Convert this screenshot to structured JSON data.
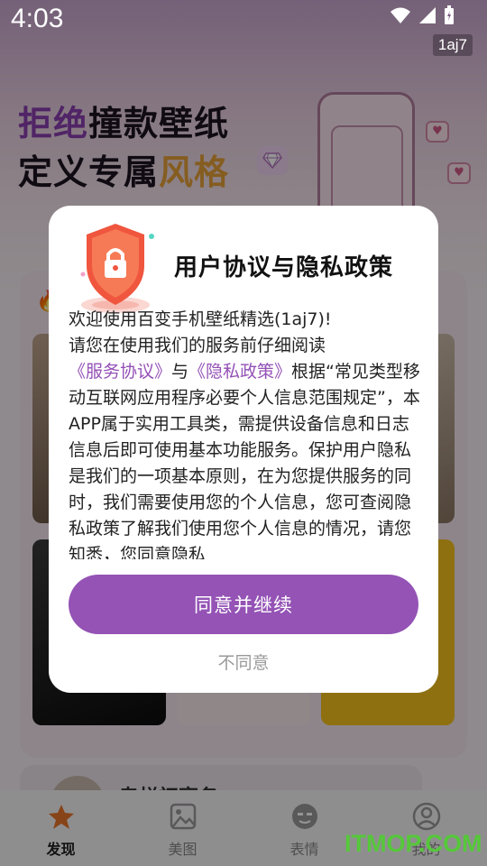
{
  "status_bar": {
    "time": "4:03",
    "version_badge": "1aj7"
  },
  "hero": {
    "line1_highlight": "拒绝",
    "line1_rest": "撞款壁纸",
    "line2_start": "定义专属",
    "line2_highlight": "风格"
  },
  "background_card": {
    "title_partial": "专栏初享务"
  },
  "dialog": {
    "title": "用户协议与隐私政策",
    "body_line1": "欢迎使用百变手机壁纸精选(1aj7)!",
    "body_pre": "请您在使用我们的服务前仔细阅读",
    "link_service": "《服务协议》",
    "body_and": "与",
    "link_privacy": "《隐私政策》",
    "body_post": "根据“常见类型移动互联网应用程序必要个人信息范围规定”，本APP属于实用工具类，需提供设备信息和日志信息后即可使用基本功能服务。保护用户隐私是我们的一项基本原则，在为您提供服务的同时，我们需要使用您的个人信息，您可查阅隐私政策了解我们使用您个人信息的情况，请您知悉，您同意隐私",
    "agree_label": "同意并继续",
    "disagree_label": "不同意"
  },
  "tabbar": {
    "items": [
      {
        "label": "发现",
        "icon": "star-icon",
        "active": true
      },
      {
        "label": "美图",
        "icon": "image-icon",
        "active": false
      },
      {
        "label": "表情",
        "icon": "emoji-icon",
        "active": false
      },
      {
        "label": "我的",
        "icon": "profile-icon",
        "active": false
      }
    ]
  },
  "watermark": "ITMOP.COM",
  "colors": {
    "accent": "#9453b5",
    "link": "#9451b6",
    "shield": "#f0553e"
  }
}
